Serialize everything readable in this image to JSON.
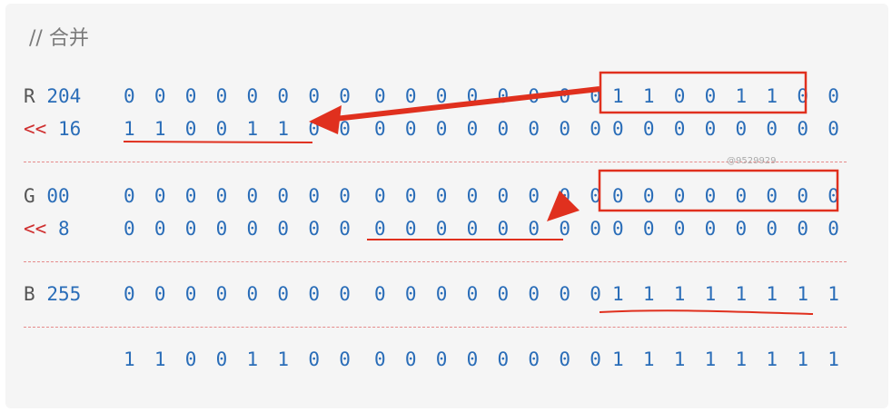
{
  "comment": "// 合并",
  "watermark": "@9529929",
  "rows": {
    "r": {
      "label": "R",
      "value": "204",
      "b1": "0 0 0 0 0 0 0 0",
      "b2": "0 0 0 0 0 0 0 0",
      "b3": "1 1 0 0 1 1 0 0"
    },
    "r_shift": {
      "op": "<<",
      "value": "16",
      "b1": "1 1 0 0 1 1 0 0",
      "b2": "0 0 0 0 0 0 0 0",
      "b3": "0 0 0 0 0 0 0 0"
    },
    "g": {
      "label": "G",
      "value": "00",
      "b1": "0 0 0 0 0 0 0 0",
      "b2": "0 0 0 0 0 0 0 0",
      "b3": "0 0 0 0 0 0 0 0"
    },
    "g_shift": {
      "op": "<<",
      "value": "8",
      "b1": "0 0 0 0 0 0 0 0",
      "b2": "0 0 0 0 0 0 0 0",
      "b3": "0 0 0 0 0 0 0 0"
    },
    "b": {
      "label": "B",
      "value": "255",
      "b1": "0 0 0 0 0 0 0 0",
      "b2": "0 0 0 0 0 0 0 0",
      "b3": "1 1 1 1 1 1 1 1"
    },
    "result": {
      "b1": "1 1 0 0 1 1 0 0",
      "b2": "0 0 0 0 0 0 0 0",
      "b3": "1 1 1 1 1 1 1 1"
    }
  },
  "colors": {
    "bits": "#2a6db8",
    "operator": "#cf2f2f",
    "annotation": "#e0301e",
    "separator": "#e58a8a",
    "background": "#f5f5f5"
  }
}
